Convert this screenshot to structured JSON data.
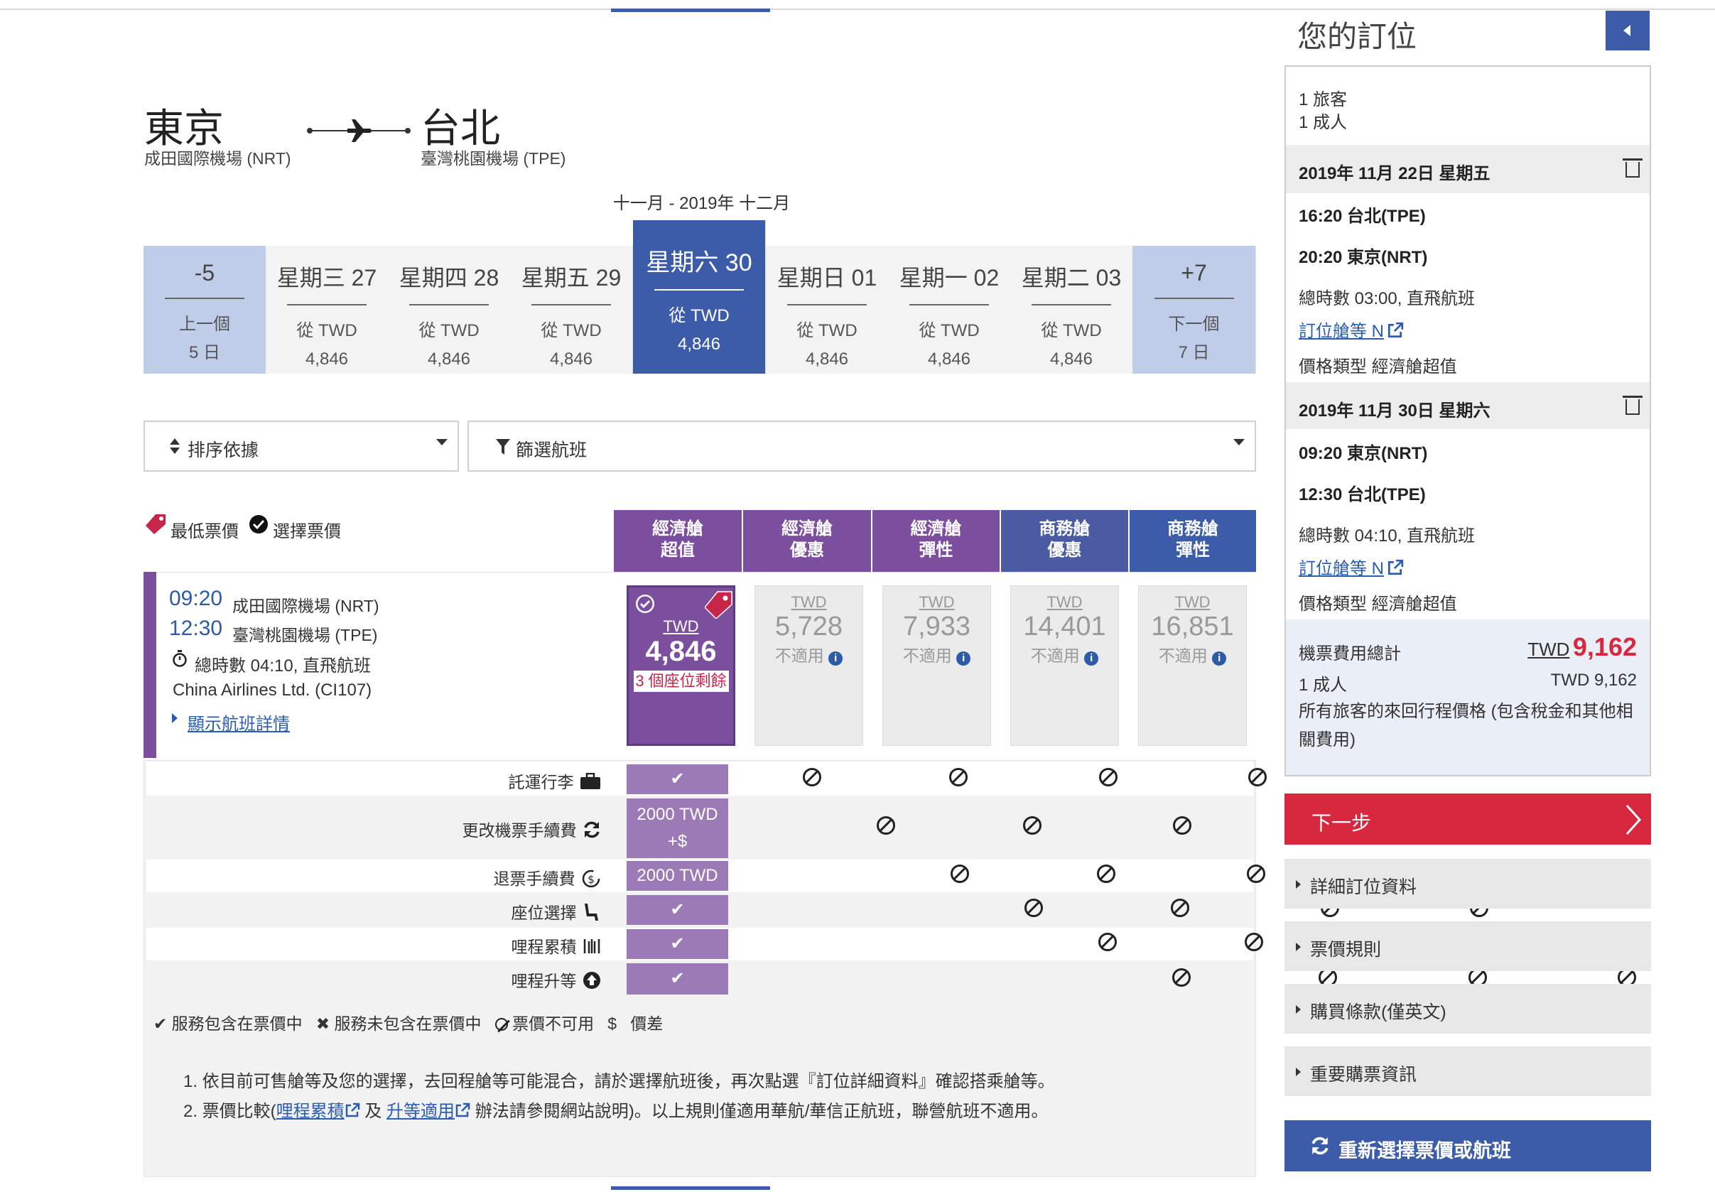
{
  "route": {
    "origin_city": "東京",
    "origin_airport": "成田國際機場 (NRT)",
    "dest_city": "台北",
    "dest_airport": "臺灣桃園機場 (TPE)",
    "plane_icon": "plane-icon"
  },
  "month_label": "十一月 - 2019年 十二月",
  "date_strip": {
    "prev": {
      "title": "-5",
      "line1": "上一個",
      "line2": "5 日"
    },
    "days": [
      {
        "title": "星期三 27",
        "line1": "從 TWD",
        "line2": "4,846"
      },
      {
        "title": "星期四 28",
        "line1": "從 TWD",
        "line2": "4,846"
      },
      {
        "title": "星期五 29",
        "line1": "從 TWD",
        "line2": "4,846"
      },
      {
        "title": "星期六 30",
        "line1": "從 TWD",
        "line2": "4,846",
        "selected": true
      },
      {
        "title": "星期日 01",
        "line1": "從 TWD",
        "line2": "4,846"
      },
      {
        "title": "星期一 02",
        "line1": "從 TWD",
        "line2": "4,846"
      },
      {
        "title": "星期二 03",
        "line1": "從 TWD",
        "line2": "4,846"
      }
    ],
    "next": {
      "title": "+7",
      "line1": "下一個",
      "line2": "7 日"
    }
  },
  "controls": {
    "sort_label": "排序依據",
    "filter_label": "篩選航班"
  },
  "legend": {
    "lowest": "最低票價",
    "selected": "選擇票價"
  },
  "fare_headers": [
    {
      "line1": "經濟艙",
      "line2": "超值",
      "color": "#7b4f9d"
    },
    {
      "line1": "經濟艙",
      "line2": "優惠",
      "color": "#7b4f9d"
    },
    {
      "line1": "經濟艙",
      "line2": "彈性",
      "color": "#7b4f9d"
    },
    {
      "line1": "商務艙",
      "line2": "優惠",
      "color": "#4a5aa3"
    },
    {
      "line1": "商務艙",
      "line2": "彈性",
      "color": "#3c5ba9"
    }
  ],
  "flight": {
    "dep_time": "09:20",
    "dep_airport": "成田國際機場 (NRT)",
    "arr_time": "12:30",
    "arr_airport": "臺灣桃園機場 (TPE)",
    "duration": "總時數 04:10, 直飛航班",
    "carrier": "China Airlines Ltd. (CI107)",
    "details_link": "顯示航班詳情"
  },
  "fares": {
    "selected": {
      "currency": "TWD",
      "amount": "4,846",
      "seats": "3 個座位剩餘"
    },
    "others": [
      {
        "currency": "TWD",
        "amount": "5,728",
        "status": "不適用"
      },
      {
        "currency": "TWD",
        "amount": "7,933",
        "status": "不適用"
      },
      {
        "currency": "TWD",
        "amount": "14,401",
        "status": "不適用"
      },
      {
        "currency": "TWD",
        "amount": "16,851",
        "status": "不適用"
      }
    ]
  },
  "services": [
    {
      "label": "託運行李",
      "icon": "suitcase-icon",
      "selected_value": "✔"
    },
    {
      "label": "更改機票手續費",
      "icon": "refresh-icon",
      "selected_value": "2000 TWD +$"
    },
    {
      "label": "退票手續費",
      "icon": "refund-icon",
      "selected_value": "2000 TWD"
    },
    {
      "label": "座位選擇",
      "icon": "seat-icon",
      "selected_value": "✔"
    },
    {
      "label": "哩程累積",
      "icon": "mileage-icon",
      "selected_value": "✔"
    },
    {
      "label": "哩程升等",
      "icon": "upgrade-icon",
      "selected_value": "✔"
    }
  ],
  "service_key": {
    "included": "服務包含在票價中",
    "excluded": "服務未包含在票價中",
    "unavailable": "票價不可用",
    "diff_symbol": "$",
    "diff": "價差"
  },
  "notes": {
    "n1": "1. 依目前可售艙等及您的選擇，去回程艙等可能混合，請於選擇航班後，再次點選『訂位詳細資料』確認搭乘艙等。",
    "n2_pre": "2. 票價比較(",
    "n2_link1": "哩程累積",
    "n2_mid": "及",
    "n2_link2": "升等適用",
    "n2_post": "辦法請參閱網站說明)。以上規則僅適用華航/華信正航班，聯營航班不適用。"
  },
  "sidebar": {
    "title": "您的訂位",
    "travelers": "1 旅客",
    "adults": "1 成人",
    "segments": [
      {
        "date": "2019年 11月 22日 星期五",
        "dep": "16:20 台北(TPE)",
        "arr": "20:20 東京(NRT)",
        "duration": "總時數 03:00, 直飛航班",
        "class_link": "訂位艙等 N",
        "fare_type": "價格類型 經濟艙超值"
      },
      {
        "date": "2019年 11月 30日 星期六",
        "dep": "09:20 東京(NRT)",
        "arr": "12:30 台北(TPE)",
        "duration": "總時數 04:10, 直飛航班",
        "class_link": "訂位艙等 N",
        "fare_type": "價格類型 經濟艙超值"
      }
    ],
    "total_label": "機票費用總計",
    "total_currency": "TWD",
    "total_amount": "9,162",
    "adult_label": "1 成人",
    "adult_price": "TWD 9,162",
    "total_note": "所有旅客的來回行程價格 (包含稅金和其他相關費用)",
    "next_label": "下一步",
    "accordions": [
      "詳細訂位資料",
      "票價規則",
      "購買條款(僅英文)",
      "重要購票資訊"
    ],
    "reselect_label": "重新選擇票價或航班"
  }
}
